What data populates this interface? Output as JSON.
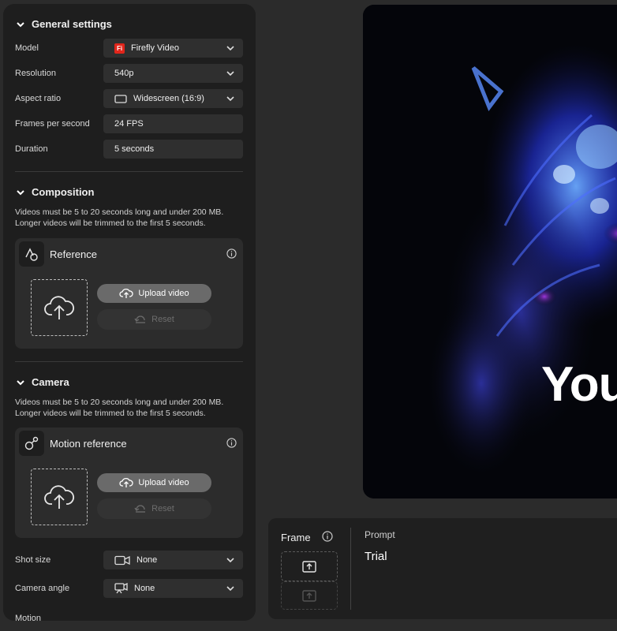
{
  "general": {
    "title": "General settings",
    "model_label": "Model",
    "model_badge": "Fi",
    "model_value": "Firefly Video",
    "resolution_label": "Resolution",
    "resolution_value": "540p",
    "aspect_label": "Aspect ratio",
    "aspect_value": "Widescreen (16:9)",
    "fps_label": "Frames per second",
    "fps_value": "24 FPS",
    "duration_label": "Duration",
    "duration_value": "5 seconds"
  },
  "composition": {
    "title": "Composition",
    "note_line1": "Videos must be 5 to 20 seconds long and under 200 MB.",
    "note_line2": "Longer videos will be trimmed to the first 5 seconds.",
    "card_title": "Reference",
    "upload_label": "Upload video",
    "reset_label": "Reset"
  },
  "camera": {
    "title": "Camera",
    "note_line1": "Videos must be 5 to 20 seconds long and under 200 MB.",
    "note_line2": "Longer videos will be trimmed to the first 5 seconds.",
    "card_title": "Motion reference",
    "upload_label": "Upload video",
    "reset_label": "Reset",
    "shot_size_label": "Shot size",
    "shot_size_value": "None",
    "camera_angle_label": "Camera angle",
    "camera_angle_value": "None",
    "motion_label": "Motion"
  },
  "preview": {
    "overlay_text": "You"
  },
  "prompt_bar": {
    "frame_label": "Frame",
    "prompt_label": "Prompt",
    "prompt_value": "Trial"
  },
  "colors": {
    "model_badge": "#e1251b",
    "panel_bg": "#1e1e1e",
    "page_bg": "#2b2b2b"
  }
}
